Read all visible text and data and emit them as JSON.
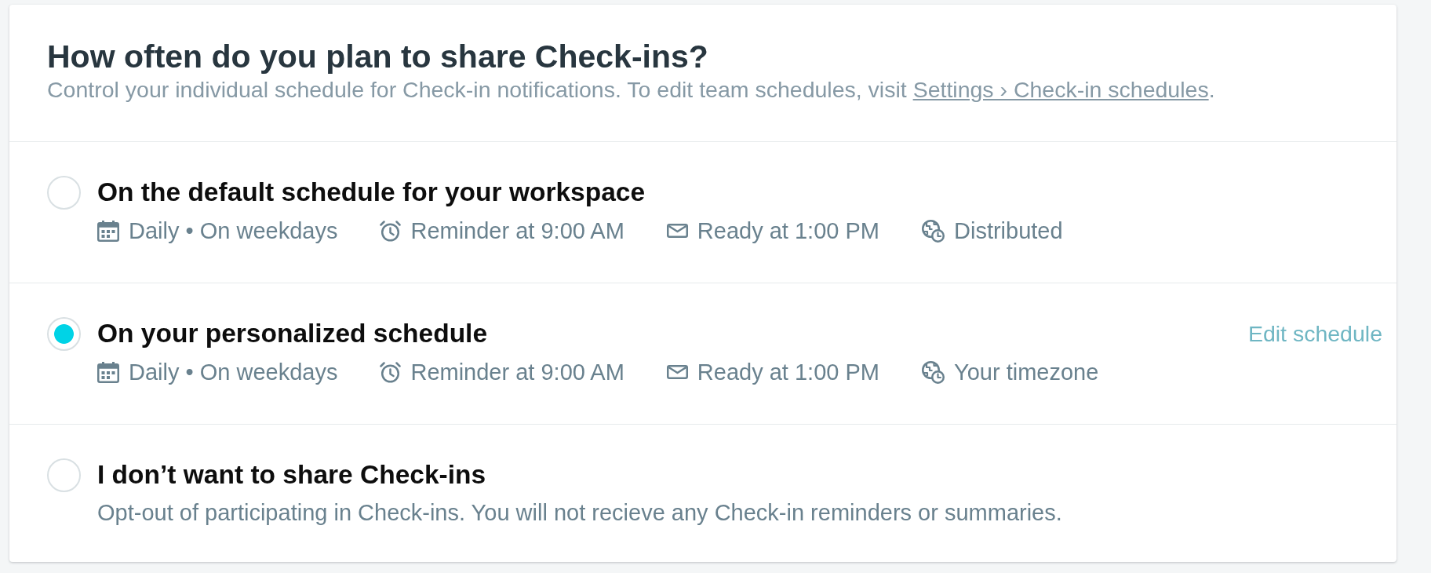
{
  "header": {
    "title": "How often do you plan to share Check-ins?",
    "subtitle": {
      "text": "Control your individual schedule for Check-in notifications. To edit team schedules, visit ",
      "link": "Settings › Check-in schedules",
      "end": "."
    }
  },
  "options": [
    {
      "kind": "schedule",
      "selected": false,
      "title": "On the default schedule for your workspace",
      "details": [
        {
          "kind": "frequency",
          "text": "Daily • On weekdays"
        },
        {
          "kind": "reminder",
          "text": "Reminder at 9:00 AM"
        },
        {
          "kind": "delivery",
          "text": "Ready at 1:00 PM"
        },
        {
          "kind": "timezone",
          "text": "Distributed"
        }
      ]
    },
    {
      "kind": "schedule",
      "selected": true,
      "title": "On your personalized schedule",
      "action": "Edit schedule",
      "details": [
        {
          "kind": "frequency",
          "text": "Daily • On weekdays"
        },
        {
          "kind": "reminder",
          "text": "Reminder at 9:00 AM"
        },
        {
          "kind": "delivery",
          "text": "Ready at 1:00 PM"
        },
        {
          "kind": "timezone",
          "text": "Your timezone"
        }
      ]
    },
    {
      "kind": "opt-out",
      "selected": false,
      "title": "I don’t want to share Check-ins",
      "description": "Opt-out of participating in Check-ins. You will not recieve any Check-in reminders or summaries."
    }
  ]
}
